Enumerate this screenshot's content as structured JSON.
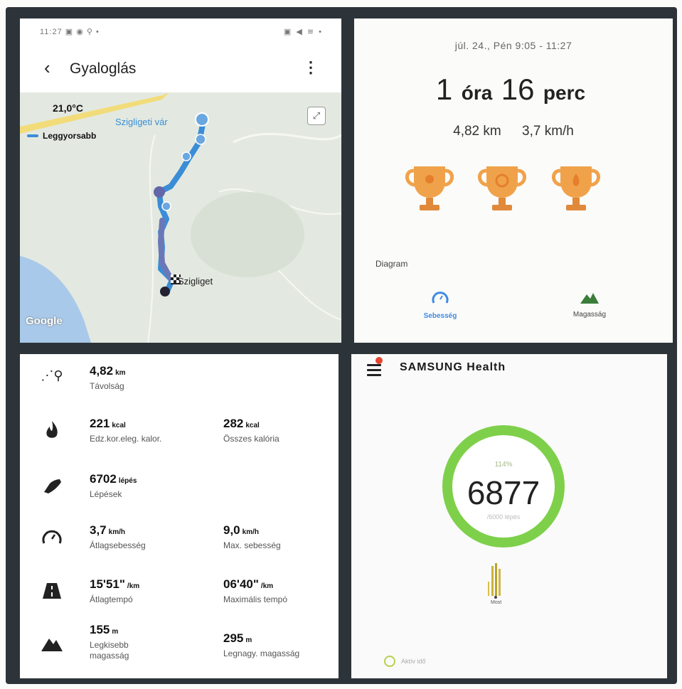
{
  "walk": {
    "status_time": "11:27",
    "status_icons": "▣ ◉ ⚲ •",
    "status_right": "▣ ◀ ≋ •",
    "title": "Gyaloglás",
    "map": {
      "temperature": "21,0°C",
      "legend_label": "Leggyorsabb",
      "poi_label": "Szigligeti vár",
      "dest_label": "Szigliget",
      "attribution": "Google"
    }
  },
  "summary": {
    "date": "júl. 24., Pén 9:05 - 11:27",
    "duration_h": "1",
    "duration_h_unit": "óra",
    "duration_m": "16",
    "duration_m_unit": "perc",
    "distance": "4,82 km",
    "speed": "3,7 km/h",
    "diagram_label": "Diagram",
    "tabs": [
      {
        "label": "Sebesség",
        "icon": "speedometer-icon",
        "color": "#3d8ce0"
      },
      {
        "label": "Magasság",
        "icon": "mountain-icon",
        "color": "#3a7d3a"
      }
    ]
  },
  "stats": {
    "distance": {
      "value": "4,82",
      "unit": "km",
      "label": "Távolság"
    },
    "kcal_workout": {
      "value": "221",
      "unit": "kcal",
      "label": "Edz.kor.eleg. kalor."
    },
    "kcal_total": {
      "value": "282",
      "unit": "kcal",
      "label": "Összes kalória"
    },
    "steps": {
      "value": "6702",
      "unit": "lépés",
      "label": "Lépések"
    },
    "avg_speed": {
      "value": "3,7",
      "unit": "km/h",
      "label": "Átlagsebesség"
    },
    "max_speed": {
      "value": "9,0",
      "unit": "km/h",
      "label": "Max. sebesség"
    },
    "avg_pace": {
      "value": "15'51\"",
      "unit": "/km",
      "label": "Átlagtempó"
    },
    "max_pace": {
      "value": "06'40\"",
      "unit": "/km",
      "label": "Maximális tempó"
    },
    "min_alt": {
      "value": "155",
      "unit": "m",
      "label": "Legkisebb magasság"
    },
    "max_alt": {
      "value": "295",
      "unit": "m",
      "label": "Legnagy. magasság"
    }
  },
  "health": {
    "brand": "SAMSUNG Health",
    "percent": "114%",
    "steps": "6877",
    "goal": "/6000 lépés",
    "now_label": "Most",
    "active_label": "Aktív idő",
    "ring_color": "#7ed04a"
  }
}
